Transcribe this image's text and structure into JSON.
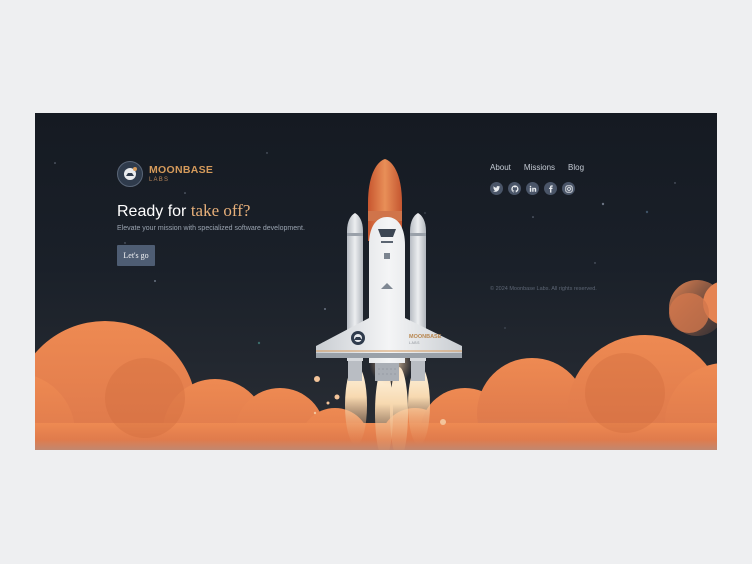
{
  "brand": {
    "name": "MOONBASE",
    "sub": "LABS"
  },
  "hero": {
    "headline_prefix": "Ready for ",
    "headline_accent": "take off?",
    "tagline": "Elevate your mission with specialized software development.",
    "cta_label": "Let's go"
  },
  "nav": {
    "items": [
      {
        "label": "About"
      },
      {
        "label": "Missions"
      },
      {
        "label": "Blog"
      }
    ]
  },
  "socials": [
    {
      "icon": "twitter-icon"
    },
    {
      "icon": "github-icon"
    },
    {
      "icon": "linkedin-icon"
    },
    {
      "icon": "facebook-icon"
    },
    {
      "icon": "instagram-icon"
    }
  ],
  "footer": {
    "copyright": "© 2024 Moonbase Labs. All rights reserved."
  },
  "shuttle": {
    "brand_name": "MOONBASE",
    "brand_sub": "LABS"
  },
  "colors": {
    "background_top": "#151a22",
    "cloud_orange": "#e57d4a",
    "accent_gold": "#d59a5b",
    "button": "#4e5d73",
    "page_bg": "#eeeff1"
  }
}
